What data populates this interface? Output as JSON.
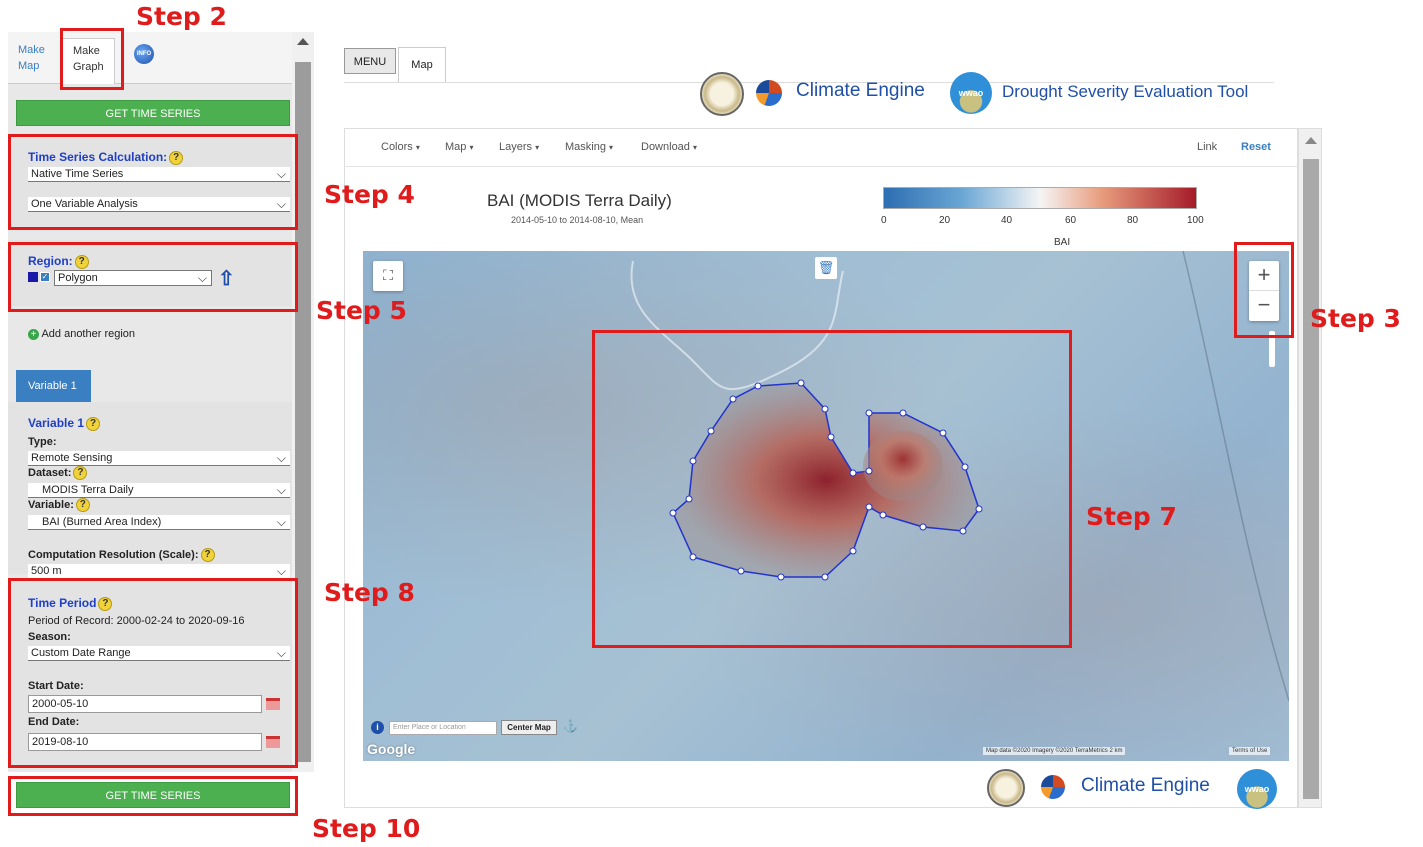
{
  "left_panel": {
    "tabs": [
      {
        "label": "Make\nMap"
      },
      {
        "label": "Make\nGraph"
      }
    ],
    "info_icon": "INFO",
    "get_time_series_top": "GET TIME SERIES",
    "time_series": {
      "title": "Time Series Calculation:",
      "calc_value": "Native Time Series",
      "analysis_value": "One Variable Analysis"
    },
    "region": {
      "title": "Region:",
      "value": "Polygon",
      "add_label": "Add another region"
    },
    "variable_tab": "Variable 1",
    "variable": {
      "title": "Variable 1",
      "type_label": "Type:",
      "type_value": "Remote Sensing",
      "dataset_label": "Dataset:",
      "dataset_value": "MODIS Terra Daily",
      "variable_label": "Variable:",
      "variable_value": "BAI (Burned Area Index)",
      "resolution_label": "Computation Resolution (Scale):",
      "resolution_value": "500 m"
    },
    "time_period": {
      "title": "Time Period",
      "record": "Period of Record: 2000-02-24 to 2020-09-16",
      "season_label": "Season:",
      "season_value": "Custom Date Range",
      "start_label": "Start Date:",
      "start_value": "2000-05-10",
      "end_label": "End Date:",
      "end_value": "2019-08-10"
    },
    "get_time_series_bottom": "GET TIME SERIES"
  },
  "header": {
    "menu_label": "MENU",
    "map_tab": "Map",
    "brand": "Climate Engine",
    "wwao": "wwao",
    "tool": "Drought Severity Evaluation Tool"
  },
  "nav": {
    "items": [
      "Colors",
      "Map",
      "Layers",
      "Masking",
      "Download"
    ],
    "link": "Link",
    "reset": "Reset"
  },
  "map": {
    "title": "BAI (MODIS Terra Daily)",
    "subtitle": "2014-05-10 to 2014-08-10, Mean",
    "legend_ticks": [
      "0",
      "20",
      "40",
      "60",
      "80",
      "100"
    ],
    "legend_title": "BAI",
    "legend_min": 0,
    "legend_max": 100,
    "search_placeholder": "Enter Place or Location",
    "center_btn": "Center Map",
    "info": "i",
    "google": "Google",
    "attribution": "Map data ©2020 Imagery ©2020 TerraMetrics   2 km",
    "terms": "Terms of Use",
    "zoom_in": "+",
    "zoom_out": "−"
  },
  "footer": {
    "brand": "Climate Engine",
    "wwao": "wwao"
  },
  "annotations": [
    "Step 2",
    "Step 4",
    "Step 5",
    "Step 3",
    "Step 7",
    "Step 8",
    "Step 10"
  ],
  "colors": {
    "annotation_red": "#e01b1b",
    "brand_blue": "#1f4fa8",
    "button_green": "#4caf50",
    "tab_blue": "#3a7fc1",
    "legend_low": "#2d6eb2",
    "legend_mid": "#f5f5f5",
    "legend_high": "#a51b29"
  }
}
